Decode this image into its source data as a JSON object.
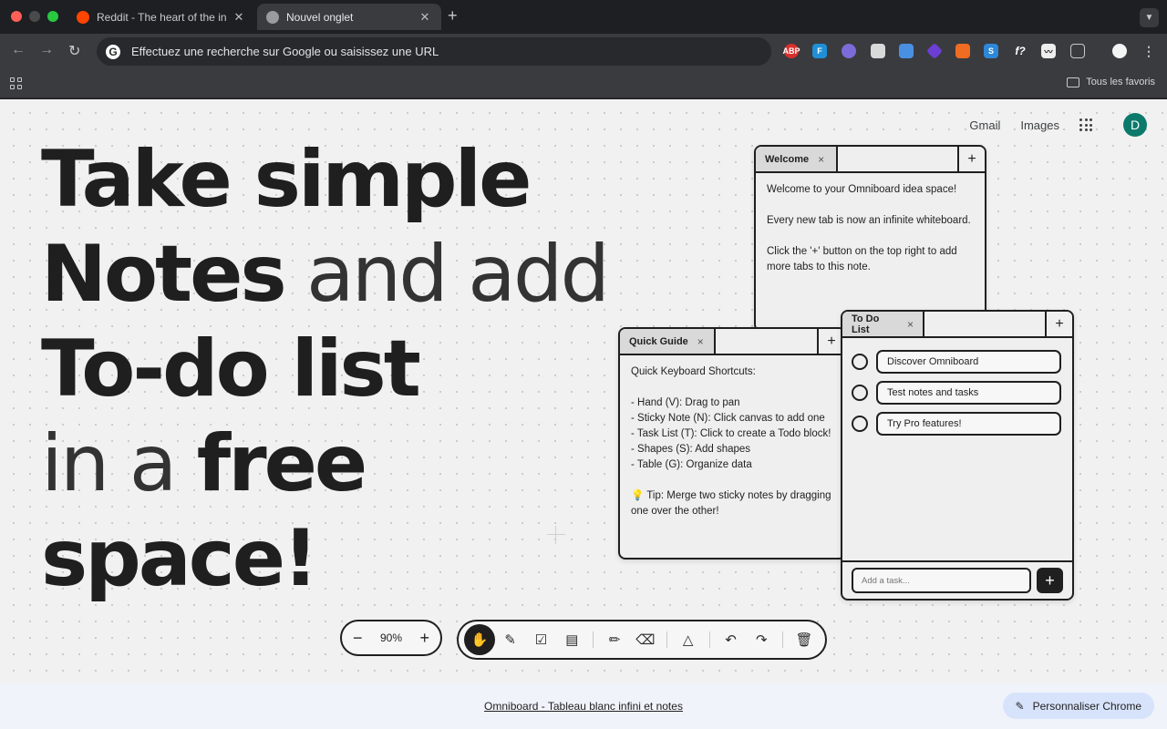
{
  "browser": {
    "tabs": [
      {
        "title": "Reddit - The heart of the internet",
        "favicon": "reddit-icon",
        "active": false
      },
      {
        "title": "Nouvel onglet",
        "favicon": "chrome-icon",
        "active": true
      }
    ],
    "new_tab_icon": "+",
    "tab_dropdown_icon": "chevron-down-icon",
    "omnibox": {
      "text": "Effectuez une recherche sur Google ou saisissez une URL",
      "icon": "G"
    },
    "extensions": [
      "ABP",
      "F",
      "ghost",
      "doc",
      "pen",
      "diamond",
      "fox",
      "S",
      "f?",
      "chart",
      "puzzle",
      "profile",
      "menu"
    ],
    "all_bookmarks_label": "Tous les favoris"
  },
  "top_links": {
    "gmail": "Gmail",
    "images": "Images",
    "avatar_letter": "D"
  },
  "hero": {
    "line1_bold": "Take simple",
    "line2_bold": "Notes",
    "line2_light": " and add",
    "line3_bold": "To-do list",
    "line4_light": "in a ",
    "line4_bold": "free",
    "line5_bold": "space!"
  },
  "notes": {
    "welcome": {
      "tab": "Welcome",
      "close": "×",
      "add": "+",
      "paragraphs": [
        "Welcome to your Omniboard idea space!",
        "Every new tab is now an infinite whiteboard.",
        "Click the '+' button on the top right to add more tabs to this note."
      ]
    },
    "guide": {
      "tab": "Quick Guide",
      "close": "×",
      "add": "+",
      "heading": "Quick Keyboard Shortcuts:",
      "lines": [
        "- Hand (V): Drag to pan",
        "- Sticky Note (N): Click canvas to add one",
        "- Task List (T): Click to create a Todo block!",
        "- Shapes (S): Add shapes",
        "- Table (G): Organize data"
      ],
      "tip": "💡 Tip: Merge two sticky notes by dragging one over the other!"
    },
    "todo": {
      "tab": "To Do List",
      "close": "×",
      "add": "+",
      "items": [
        "Discover Omniboard",
        "Test notes and tasks",
        "Try Pro features!"
      ],
      "input_placeholder": "Add a task...",
      "add_button": "+"
    }
  },
  "zoom": {
    "minus": "−",
    "value": "90%",
    "plus": "+"
  },
  "tools": [
    "hand-icon",
    "edit-icon",
    "checklist-icon",
    "table-icon",
    "pencil-icon",
    "eraser-icon",
    "triangle-icon",
    "undo-icon",
    "redo-icon",
    "trash-icon"
  ],
  "footer": {
    "link": "Omniboard - Tableau blanc infini et notes",
    "customize": "Personnaliser Chrome"
  },
  "colors": {
    "accent": "#1f1f1f",
    "avatar": "#0b7a6b",
    "customize_bg": "#d7e3fb"
  }
}
